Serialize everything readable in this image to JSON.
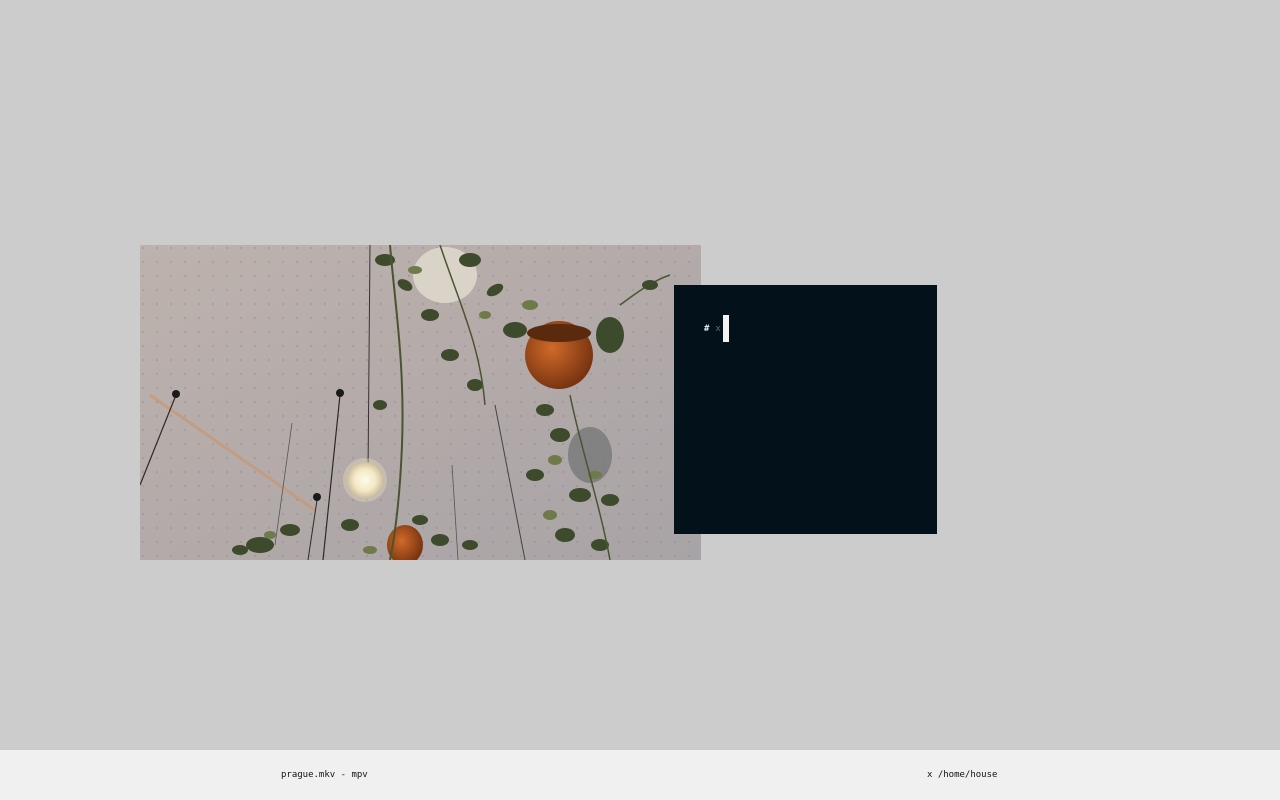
{
  "desktop": {
    "background_color": "#cccccc"
  },
  "mpv_window": {
    "video_description_icon": "video-frame"
  },
  "terminal": {
    "background_color": "#03111a",
    "prompt": "#",
    "command": "x"
  },
  "taskbar": {
    "background_color": "#f0f0f0",
    "tasks": [
      {
        "label": "prague.mkv - mpv"
      },
      {
        "label": "x /home/house"
      }
    ]
  }
}
